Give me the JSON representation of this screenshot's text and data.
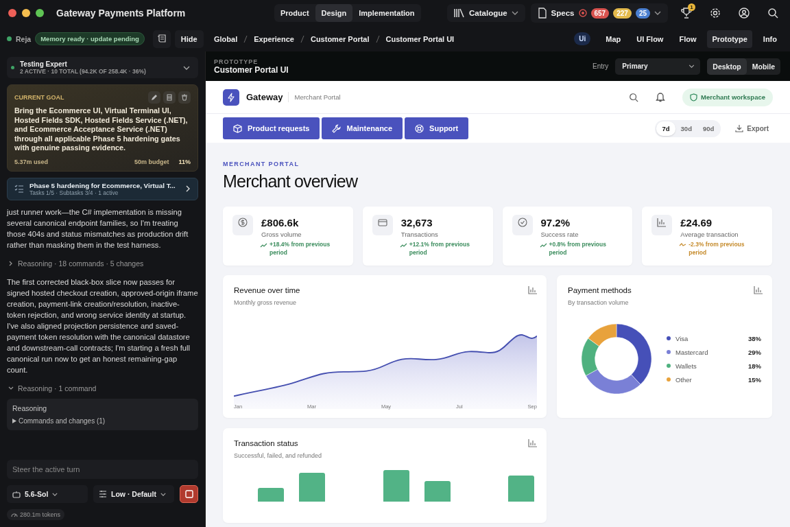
{
  "window": {
    "title": "Gateway Payments Platform"
  },
  "mode_tabs": [
    {
      "label": "Product",
      "selected": false
    },
    {
      "label": "Design",
      "selected": true
    },
    {
      "label": "Implementation",
      "selected": false
    }
  ],
  "catalogue": {
    "label": "Catalogue"
  },
  "specs": {
    "label": "Specs",
    "badges": [
      {
        "text": "657",
        "color": "#d9534f"
      },
      {
        "text": "227",
        "color": "#e3b94c"
      },
      {
        "text": "25",
        "color": "#4a7fd0"
      }
    ]
  },
  "trophy_badge": "1",
  "agent": {
    "name": "Reja",
    "memory": "Memory ready · update pending"
  },
  "hide_button": "Hide",
  "breadcrumb": [
    "Global",
    "Experience",
    "Customer Portal",
    "Customer Portal UI"
  ],
  "view_badge": "Ui",
  "view_tabs": [
    {
      "label": "Map",
      "selected": false
    },
    {
      "label": "UI Flow",
      "selected": false
    },
    {
      "label": "Flow",
      "selected": false
    },
    {
      "label": "Prototype",
      "selected": true
    },
    {
      "label": "Info",
      "selected": false
    }
  ],
  "team": {
    "title": "Testing Expert",
    "summary": "2 ACTIVE · 10 TOTAL (94.2K OF 258.4K · 36%)"
  },
  "goal": {
    "label": "CURRENT GOAL",
    "text": "Bring the Ecommerce UI, Virtual Terminal UI, Hosted Fields SDK, Hosted Fields Service (.NET), and Ecommerce Acceptance Service (.NET) through all applicable Phase 5 hardening gates with genuine passing evidence.",
    "used": "5.37m used",
    "budget": "50m budget",
    "percent": "11%"
  },
  "task": {
    "title": "Phase 5 hardening for Ecommerce, Virtual T...",
    "meta": "Tasks 1/5 · Subtasks 3/4 · 1 active"
  },
  "messages": [
    {
      "kind": "text",
      "text": "just runner work—the C# implementation is missing several canonical endpoint families, so I'm treating those 404s and status mismatches as production drift rather than masking them in the test harness."
    },
    {
      "kind": "reasoning",
      "label": "Reasoning · 18 commands · 5 changes",
      "expanded": false
    },
    {
      "kind": "text",
      "text": "The first corrected black-box slice now passes for signed hosted checkout creation, approved-origin iframe creation, payment-link creation/resolution, inactive-token rejection, and wrong service identity at startup. I've also aligned projection persistence and saved-payment token resolution with the canonical datastore and downstream-call contracts; I'm starting a fresh full canonical run now to get an honest remaining-gap count."
    },
    {
      "kind": "reasoning",
      "label": "Reasoning · 1 command",
      "expanded": true,
      "box_title": "Reasoning",
      "box_item": "Commands and changes (1)"
    }
  ],
  "composer": {
    "placeholder": "Steer the active turn",
    "model": "5.6-Sol",
    "effort": "Low · Default",
    "tokens": "280.1m tokens"
  },
  "prototype": {
    "label": "PROTOTYPE",
    "title": "Customer Portal UI",
    "entry_label": "Entry",
    "entry_value": "Primary",
    "devices": [
      {
        "label": "Desktop",
        "selected": true
      },
      {
        "label": "Mobile",
        "selected": false
      }
    ]
  },
  "portal": {
    "brand": "Gateway",
    "subtitle": "Merchant Portal",
    "workspace": "Merchant workspace",
    "nav": [
      {
        "label": "Product requests",
        "kind": "box"
      },
      {
        "label": "Maintenance",
        "kind": "wrench"
      },
      {
        "label": "Support",
        "kind": "lifebuoy"
      }
    ],
    "ranges": [
      {
        "label": "7d",
        "selected": true
      },
      {
        "label": "30d",
        "selected": false
      },
      {
        "label": "90d",
        "selected": false
      }
    ],
    "export": "Export",
    "eyebrow": "MERCHANT PORTAL",
    "heading": "Merchant overview",
    "stats": [
      {
        "kind": "money",
        "value": "£806.6k",
        "label": "Gross volume",
        "change": "+18.4% from previous period",
        "declining": false
      },
      {
        "kind": "card",
        "value": "32,673",
        "label": "Transactions",
        "change": "+12.1% from previous period",
        "declining": false
      },
      {
        "kind": "check",
        "value": "97.2%",
        "label": "Success rate",
        "change": "+0.8% from previous period",
        "declining": false
      },
      {
        "kind": "bars",
        "value": "£24.69",
        "label": "Average transaction",
        "change": "-2.3% from previous period",
        "declining": true
      }
    ],
    "revenue": {
      "title": "Revenue over time",
      "subtitle": "Monthly gross revenue",
      "months": [
        "Jan",
        "Mar",
        "May",
        "Jul",
        "Sep"
      ]
    },
    "payment_methods": {
      "title": "Payment methods",
      "subtitle": "By transaction volume",
      "chart_data": {
        "type": "donut",
        "categories": [
          "Visa",
          "Mastercard",
          "Wallets",
          "Other"
        ],
        "values": [
          38,
          29,
          18,
          15
        ],
        "value_labels": [
          "38%",
          "29%",
          "18%",
          "15%"
        ],
        "colors": [
          "#4650b8",
          "#7a80d6",
          "#4fb17f",
          "#e8a23c"
        ],
        "legend": "right"
      }
    },
    "status": {
      "title": "Transaction status",
      "subtitle": "Successful, failed, and refunded"
    }
  }
}
